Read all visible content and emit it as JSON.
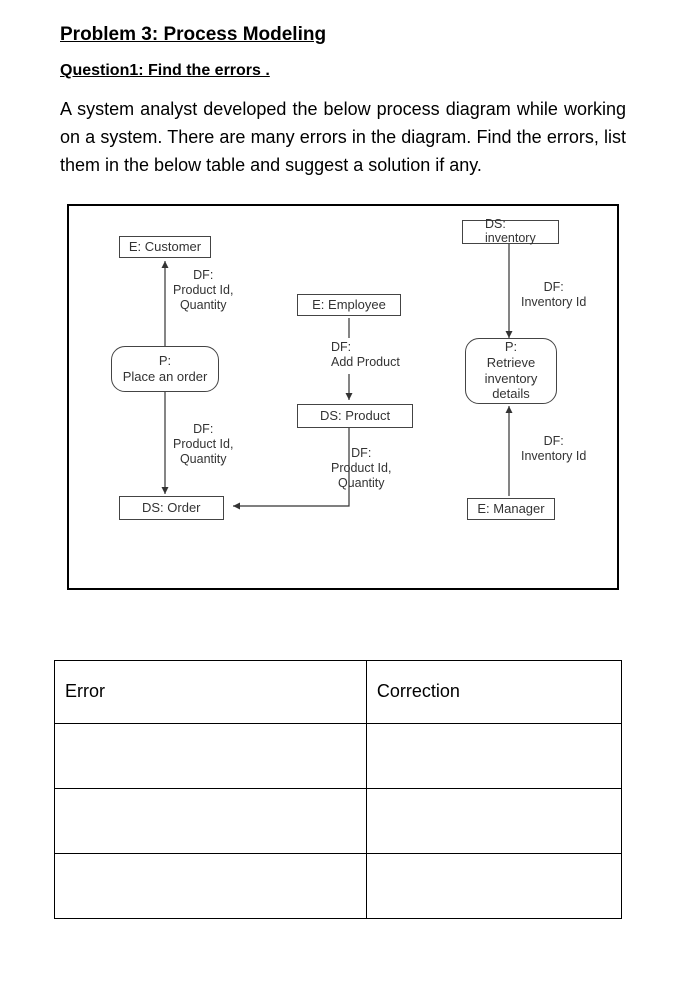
{
  "title": "Problem 3: Process Modeling",
  "subtitle": "Question1: Find the errors .",
  "body": "A system analyst developed the below process diagram while working on a system. There are many errors in the diagram. Find the errors, list them in the below table and suggest a solution if any.",
  "diagram": {
    "entities": {
      "customer": "E: Customer",
      "employee": "E: Employee",
      "manager": "E: Manager"
    },
    "processes": {
      "place_order": "P:\nPlace an order",
      "retrieve_inventory": "P:\nRetrieve\ninventory\ndetails"
    },
    "datastores": {
      "inventory": "DS:\ninventory",
      "product": "DS: Product",
      "order": "DS: Order"
    },
    "dataflows": {
      "df_product_id_qty_1": "DF:\nProduct Id,\nQuantity",
      "df_add_product": "DF:\nAdd Product",
      "df_product_id_qty_2": "DF:\nProduct Id,\nQuantity",
      "df_product_id_qty_3": "DF:\nProduct Id,\nQuantity",
      "df_inventory_id_1": "DF:\nInventory Id",
      "df_inventory_id_2": "DF:\nInventory Id"
    }
  },
  "table": {
    "header_error": "Error",
    "header_correction": "Correction",
    "rows": [
      "",
      "",
      ""
    ]
  }
}
